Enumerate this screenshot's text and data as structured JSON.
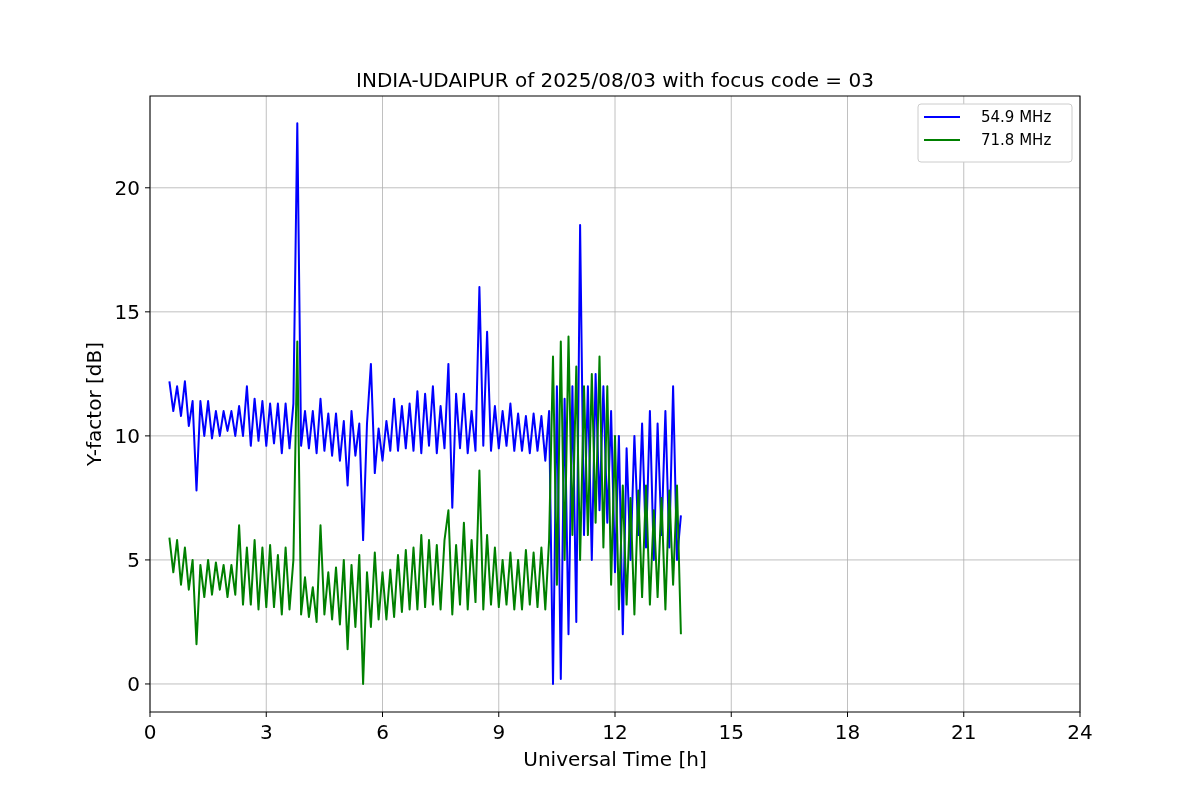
{
  "chart_data": {
    "type": "line",
    "title": "INDIA-UDAIPUR of 2025/08/03 with focus code = 03",
    "xlabel": "Universal Time [h]",
    "ylabel": "Y-factor [dB]",
    "x": [
      0.5,
      0.6,
      0.7,
      0.8,
      0.9,
      1.0,
      1.1,
      1.2,
      1.3,
      1.4,
      1.5,
      1.6,
      1.7,
      1.8,
      1.9,
      2.0,
      2.1,
      2.2,
      2.3,
      2.4,
      2.5,
      2.6,
      2.7,
      2.8,
      2.9,
      3.0,
      3.1,
      3.2,
      3.3,
      3.4,
      3.5,
      3.6,
      3.7,
      3.8,
      3.9,
      4.0,
      4.1,
      4.2,
      4.3,
      4.4,
      4.5,
      4.6,
      4.7,
      4.8,
      4.9,
      5.0,
      5.1,
      5.2,
      5.3,
      5.4,
      5.5,
      5.6,
      5.7,
      5.8,
      5.9,
      6.0,
      6.1,
      6.2,
      6.3,
      6.4,
      6.5,
      6.6,
      6.7,
      6.8,
      6.9,
      7.0,
      7.1,
      7.2,
      7.3,
      7.4,
      7.5,
      7.6,
      7.7,
      7.8,
      7.9,
      8.0,
      8.1,
      8.2,
      8.3,
      8.4,
      8.5,
      8.6,
      8.7,
      8.8,
      8.9,
      9.0,
      9.1,
      9.2,
      9.3,
      9.4,
      9.5,
      9.6,
      9.7,
      9.8,
      9.9,
      10.0,
      10.1,
      10.2,
      10.3,
      10.4,
      10.5,
      10.6,
      10.7,
      10.8,
      10.9,
      11.0,
      11.1,
      11.2,
      11.3,
      11.4,
      11.5,
      11.6,
      11.7,
      11.8,
      11.9,
      12.0,
      12.1,
      12.2,
      12.3,
      12.4,
      12.5,
      12.6,
      12.7,
      12.8,
      12.9,
      13.0,
      13.1,
      13.2,
      13.3,
      13.4,
      13.5,
      13.6,
      13.7
    ],
    "series": [
      {
        "name": "54.9 MHz",
        "color": "#0000ff",
        "values": [
          12.2,
          11.0,
          12.0,
          10.8,
          12.2,
          10.4,
          11.4,
          7.8,
          11.4,
          10.0,
          11.4,
          9.9,
          11.0,
          10.0,
          11.0,
          10.2,
          11.0,
          10.0,
          11.2,
          10.0,
          12.0,
          9.6,
          11.5,
          9.8,
          11.4,
          9.6,
          11.3,
          9.7,
          11.3,
          9.3,
          11.3,
          9.5,
          11.3,
          22.6,
          9.6,
          11.0,
          9.5,
          11.0,
          9.3,
          11.5,
          9.4,
          10.9,
          9.2,
          10.9,
          9.0,
          10.6,
          8.0,
          11.0,
          9.2,
          10.5,
          5.8,
          10.5,
          12.9,
          8.5,
          10.3,
          9.0,
          10.6,
          9.4,
          11.5,
          9.4,
          11.2,
          9.5,
          11.3,
          9.4,
          11.8,
          9.3,
          11.7,
          9.6,
          12.0,
          9.3,
          11.2,
          9.5,
          12.9,
          7.1,
          11.7,
          9.5,
          11.7,
          9.3,
          11.0,
          9.4,
          16.0,
          9.6,
          14.2,
          9.4,
          11.2,
          9.5,
          11.0,
          9.6,
          11.3,
          9.4,
          10.9,
          9.4,
          10.8,
          9.3,
          10.9,
          9.4,
          10.8,
          9.0,
          11.0,
          0.0,
          12.0,
          0.2,
          11.5,
          2.0,
          12.0,
          2.5,
          18.5,
          6.0,
          12.0,
          5.0,
          12.5,
          7.0,
          12.0,
          6.5,
          11.0,
          4.5,
          10.0,
          2.0,
          9.5,
          5.0,
          10.0,
          6.0,
          10.5,
          5.5,
          11.0,
          5.0,
          10.5,
          6.0,
          11.0,
          5.5,
          12.0,
          5.0,
          6.8
        ]
      },
      {
        "name": "71.8 MHz",
        "color": "#008000",
        "values": [
          5.9,
          4.5,
          5.8,
          4.0,
          5.5,
          3.8,
          5.0,
          1.6,
          4.8,
          3.5,
          5.0,
          3.6,
          4.9,
          3.8,
          4.8,
          3.5,
          4.8,
          3.6,
          6.4,
          3.2,
          5.5,
          3.2,
          5.8,
          3.0,
          5.5,
          3.1,
          5.6,
          3.1,
          5.2,
          2.8,
          5.5,
          3.0,
          5.0,
          13.8,
          2.8,
          4.3,
          2.7,
          3.9,
          2.5,
          6.4,
          2.8,
          4.5,
          2.6,
          4.7,
          2.4,
          5.0,
          1.4,
          4.8,
          2.3,
          5.2,
          0.0,
          4.5,
          2.3,
          5.3,
          2.6,
          4.5,
          2.6,
          4.6,
          2.7,
          5.2,
          2.9,
          5.4,
          3.0,
          5.5,
          3.0,
          6.0,
          3.1,
          5.8,
          3.2,
          5.6,
          3.0,
          5.8,
          7.0,
          2.8,
          5.6,
          3.2,
          6.5,
          3.0,
          5.8,
          3.3,
          8.6,
          3.0,
          6.0,
          3.2,
          5.5,
          3.1,
          5.0,
          3.2,
          5.3,
          3.0,
          5.0,
          3.0,
          5.4,
          3.2,
          5.3,
          3.1,
          5.5,
          3.0,
          5.8,
          13.2,
          4.0,
          13.8,
          5.0,
          14.0,
          6.0,
          12.8,
          5.0,
          12.0,
          6.0,
          12.5,
          6.5,
          13.2,
          5.5,
          12.0,
          4.0,
          10.0,
          3.0,
          8.0,
          3.2,
          7.5,
          2.8,
          7.8,
          3.5,
          8.0,
          3.2,
          7.0,
          3.5,
          7.5,
          3.0,
          7.8,
          4.0,
          8.0,
          2.0
        ]
      }
    ],
    "grid": true,
    "legend": true,
    "xlim": [
      0,
      24
    ],
    "ylim": [
      -1.13,
      23.7
    ],
    "xticks": [
      0,
      3,
      6,
      9,
      12,
      15,
      18,
      21,
      24
    ],
    "yticks": [
      0,
      5,
      10,
      15,
      20
    ]
  }
}
